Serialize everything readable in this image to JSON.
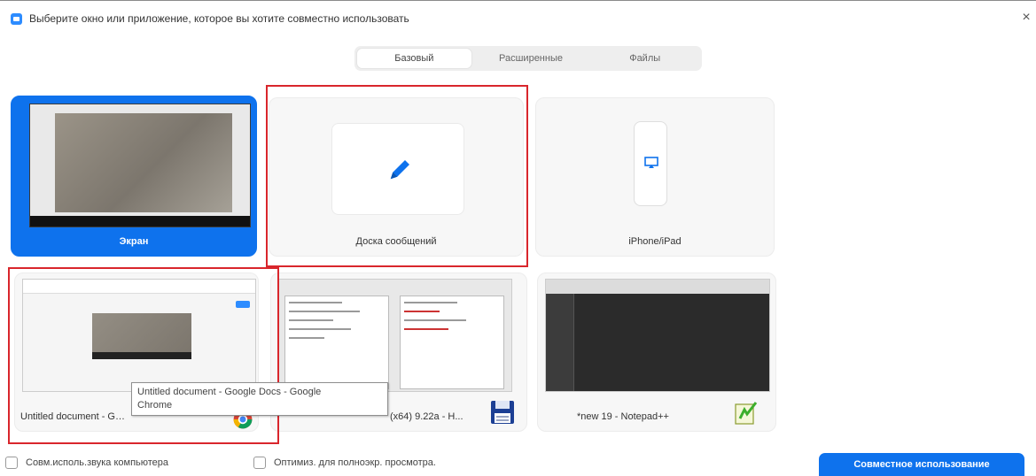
{
  "window": {
    "title": "Выберите окно или приложение, которое вы хотите совместно использовать",
    "close_glyph": "×"
  },
  "tabs": [
    {
      "label": "Базовый",
      "active": true
    },
    {
      "label": "Расширенные",
      "active": false
    },
    {
      "label": "Файлы",
      "active": false
    }
  ],
  "tiles": {
    "screen": {
      "label": "Экран",
      "selected": true
    },
    "whiteboard": {
      "label": "Доска сообщений",
      "icon": "pencil-icon"
    },
    "iphone": {
      "label": "iPhone/iPad",
      "icon": "airplay-icon"
    },
    "docs": {
      "label": "Untitled document - Google Docs - Google Chrome"
    },
    "filemanager": {
      "label": "(x64) 9.22a - H..."
    },
    "notepad": {
      "label": "*new 19 - Notepad++"
    }
  },
  "tooltip": {
    "line1": "Untitled document - Google Docs - Google",
    "line2": "Chrome"
  },
  "options": {
    "share_audio": {
      "label": "Совм.исполь.звука компьютера",
      "checked": false
    },
    "optimize_video": {
      "label": "Оптимиз. для полноэкр. просмотра.",
      "checked": false
    }
  },
  "share_button": {
    "label": "Совместное использование"
  },
  "colors": {
    "accent": "#0e72ed",
    "highlight_frame": "#d9262c"
  }
}
